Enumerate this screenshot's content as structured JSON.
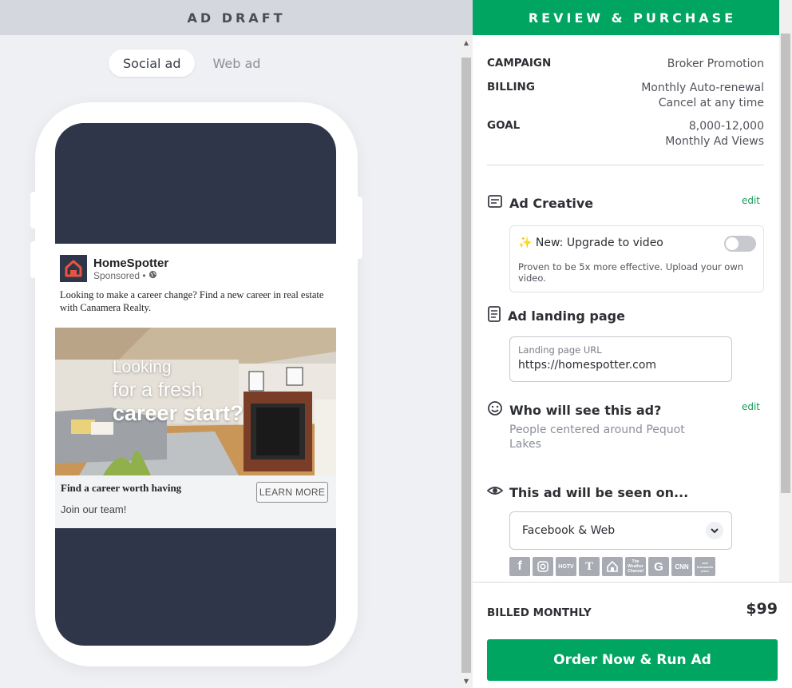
{
  "left": {
    "header": "AD DRAFT",
    "tabs": [
      {
        "label": "Social ad",
        "active": true
      },
      {
        "label": "Web ad",
        "active": false
      }
    ]
  },
  "ad": {
    "brand": "HomeSpotter",
    "sponsored": "Sponsored •",
    "text": "Looking to make a career change? Find a new career in real estate with Canamera Realty.",
    "overlay_line1": "Looking",
    "overlay_line2": "for a fresh",
    "overlay_line3": "career start?",
    "footer_title": "Find a career worth having",
    "footer_sub": "Join our team!",
    "cta": "LEARN MORE"
  },
  "right": {
    "header": "REVIEW & PURCHASE",
    "campaign_label": "CAMPAIGN",
    "campaign_value": "Broker Promotion",
    "billing_label": "BILLING",
    "billing_value1": "Monthly Auto-renewal",
    "billing_value2": "Cancel at any time",
    "goal_label": "GOAL",
    "goal_value1": "8,000-12,000",
    "goal_value2": "Monthly Ad Views",
    "creative_title": "Ad Creative",
    "edit_label": "edit",
    "upgrade_title": "✨ New: Upgrade to video",
    "upgrade_desc": "Proven to be 5x more effective. Upload your own video.",
    "upgrade_enabled": false,
    "landing_title": "Ad landing page",
    "url_label": "Landing page URL",
    "url_value": "https://homespotter.com",
    "audience_title": "Who will see this ad?",
    "audience_desc": "People centered around Pequot Lakes",
    "seen_title": "This ad will be seen on...",
    "seen_select": "Facebook & Web",
    "platforms": [
      "facebook-icon",
      "instagram-icon",
      "hgtv-icon",
      "nytimes-icon",
      "zillow-icon",
      "weather-channel-icon",
      "google-icon",
      "cnn-icon",
      "more-networks-icon"
    ],
    "billed_label": "BILLED MONTHLY",
    "price": "$99",
    "order_button": "Order Now & Run Ad"
  },
  "colors": {
    "brand_green": "#00a562",
    "phone_screen": "#2f3649",
    "logo_red": "#e8553e"
  }
}
